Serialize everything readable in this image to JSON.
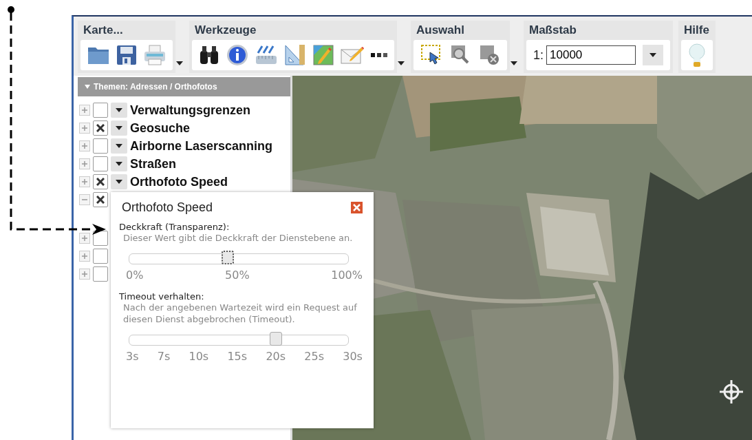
{
  "toolbar": {
    "groups": [
      {
        "title": "Karte..."
      },
      {
        "title": "Werkzeuge"
      },
      {
        "title": "Auswahl"
      },
      {
        "title": "Maßstab",
        "prefix": "1:",
        "value": "10000"
      },
      {
        "title": "Hilfe"
      }
    ]
  },
  "sidebar": {
    "header": "Themen: Adressen / Orthofotos",
    "layers": [
      {
        "label": "Verwaltungsgrenzen",
        "checked": false,
        "expanded": false
      },
      {
        "label": "Geosuche",
        "checked": true,
        "expanded": false
      },
      {
        "label": "Airborne Laserscanning",
        "checked": false,
        "expanded": false
      },
      {
        "label": "Straßen",
        "checked": false,
        "expanded": false
      },
      {
        "label": "Orthofoto Speed",
        "checked": true,
        "expanded": false
      },
      {
        "checked": true,
        "expanded": true
      },
      {
        "checked": false,
        "expanded": false
      },
      {
        "checked": false,
        "expanded": false
      },
      {
        "checked": false,
        "expanded": false
      }
    ]
  },
  "popup": {
    "title": "Orthofoto Speed",
    "sections": [
      {
        "label": "Deckkraft (Transparenz):",
        "hint": "Dieser Wert gibt die Deckkraft der Dienstebene an.",
        "level": 0.45,
        "focused": true,
        "ticks": [
          "0%",
          "50%",
          "100%"
        ]
      },
      {
        "label": "Timeout verhalten:",
        "hint": "Nach der angebenen Wartezeit wird ein Request auf diesen Dienst abgebrochen (Timeout).",
        "level": 0.67,
        "focused": false,
        "ticks": [
          "3s",
          "7s",
          "10s",
          "15s",
          "20s",
          "25s",
          "30s"
        ]
      }
    ]
  }
}
